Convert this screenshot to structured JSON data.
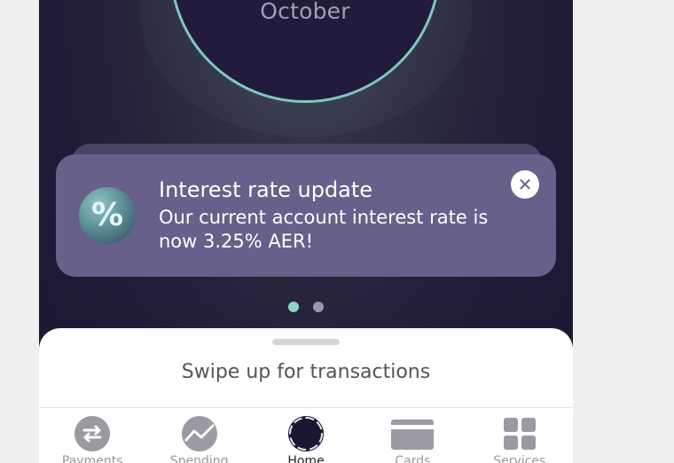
{
  "balance_ring": {
    "month_label": "October"
  },
  "notification": {
    "title": "Interest rate update",
    "body": "Our current account interest rate is now 3.25% AER!",
    "icon": "percent-icon",
    "close_icon": "close-icon"
  },
  "carousel": {
    "pages": 2,
    "active_page": 1
  },
  "bottom_sheet": {
    "hint": "Swipe up for transactions"
  },
  "tabbar": {
    "items": [
      {
        "label": "Payments",
        "icon": "transfer-arrows-icon"
      },
      {
        "label": "Spending",
        "icon": "trend-line-icon"
      },
      {
        "label": "Home",
        "icon": "home-ring-icon",
        "active": true
      },
      {
        "label": "Cards",
        "icon": "card-icon"
      },
      {
        "label": "Services",
        "icon": "grid-icon"
      }
    ]
  },
  "colors": {
    "accent_teal": "#7fc8bd",
    "background_dark": "#1f1a35",
    "card_purple": "#67608a",
    "tab_icon_grey": "#9a9aa3",
    "tab_icon_active": "#1c1632"
  }
}
